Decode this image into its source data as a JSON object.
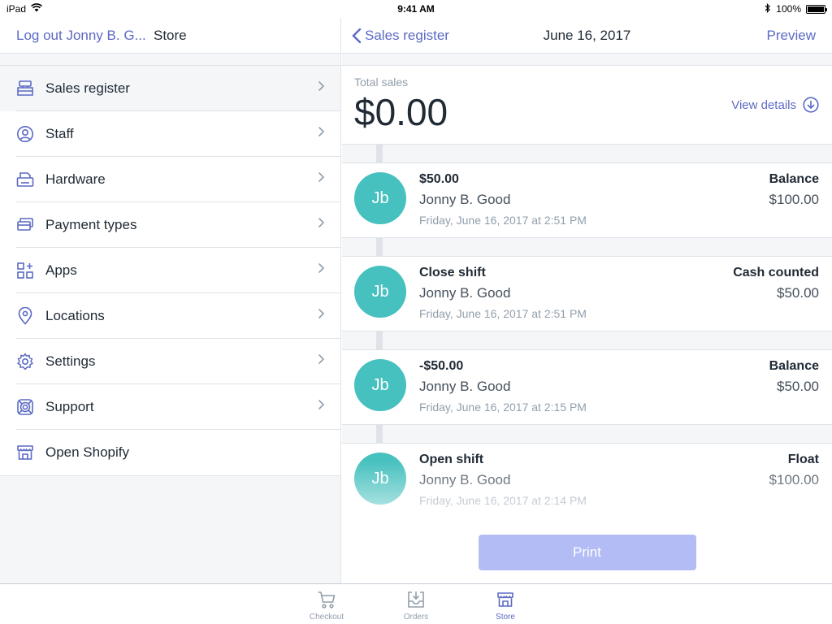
{
  "status_bar": {
    "device": "iPad",
    "time": "9:41 AM",
    "battery": "100%",
    "battery_level": 1.0
  },
  "left_nav": {
    "logout": "Log out Jonny B. G...",
    "title": "Store"
  },
  "menu": [
    {
      "label": "Sales register",
      "icon": "register-icon",
      "active": true,
      "chevron": true
    },
    {
      "label": "Staff",
      "icon": "staff-icon",
      "active": false,
      "chevron": true
    },
    {
      "label": "Hardware",
      "icon": "hardware-icon",
      "active": false,
      "chevron": true
    },
    {
      "label": "Payment types",
      "icon": "payment-icon",
      "active": false,
      "chevron": true
    },
    {
      "label": "Apps",
      "icon": "apps-icon",
      "active": false,
      "chevron": true
    },
    {
      "label": "Locations",
      "icon": "location-icon",
      "active": false,
      "chevron": true
    },
    {
      "label": "Settings",
      "icon": "gear-icon",
      "active": false,
      "chevron": true
    },
    {
      "label": "Support",
      "icon": "lifebuoy-icon",
      "active": false,
      "chevron": true
    },
    {
      "label": "Open Shopify",
      "icon": "storefront-icon",
      "active": false,
      "chevron": false
    }
  ],
  "right_nav": {
    "back": "Sales register",
    "title": "June 16, 2017",
    "preview": "Preview"
  },
  "total": {
    "label": "Total sales",
    "amount": "$0.00",
    "view_details": "View details"
  },
  "entries": [
    {
      "initials": "Jb",
      "title": "$50.00",
      "name": "Jonny B. Good",
      "time": "Friday, June 16, 2017 at 2:51 PM",
      "right_label": "Balance",
      "right_value": "$100.00"
    },
    {
      "initials": "Jb",
      "title": "Close shift",
      "name": "Jonny B. Good",
      "time": "Friday, June 16, 2017 at 2:51 PM",
      "right_label": "Cash counted",
      "right_value": "$50.00"
    },
    {
      "initials": "Jb",
      "title": "-$50.00",
      "name": "Jonny B. Good",
      "time": "Friday, June 16, 2017 at 2:15 PM",
      "right_label": "Balance",
      "right_value": "$50.00"
    },
    {
      "initials": "Jb",
      "title": "Open shift",
      "name": "Jonny B. Good",
      "time": "Friday, June 16, 2017 at 2:14 PM",
      "right_label": "Float",
      "right_value": "$100.00"
    }
  ],
  "print_label": "Print",
  "tabs": [
    {
      "label": "Checkout",
      "icon": "cart-icon",
      "active": false
    },
    {
      "label": "Orders",
      "icon": "inbox-download-icon",
      "active": false
    },
    {
      "label": "Store",
      "icon": "storefront-icon",
      "active": true
    }
  ],
  "colors": {
    "accent": "#5c6ac4",
    "avatar": "#47c1bf",
    "print_disabled": "#b3bcf5",
    "muted": "#919eab"
  }
}
